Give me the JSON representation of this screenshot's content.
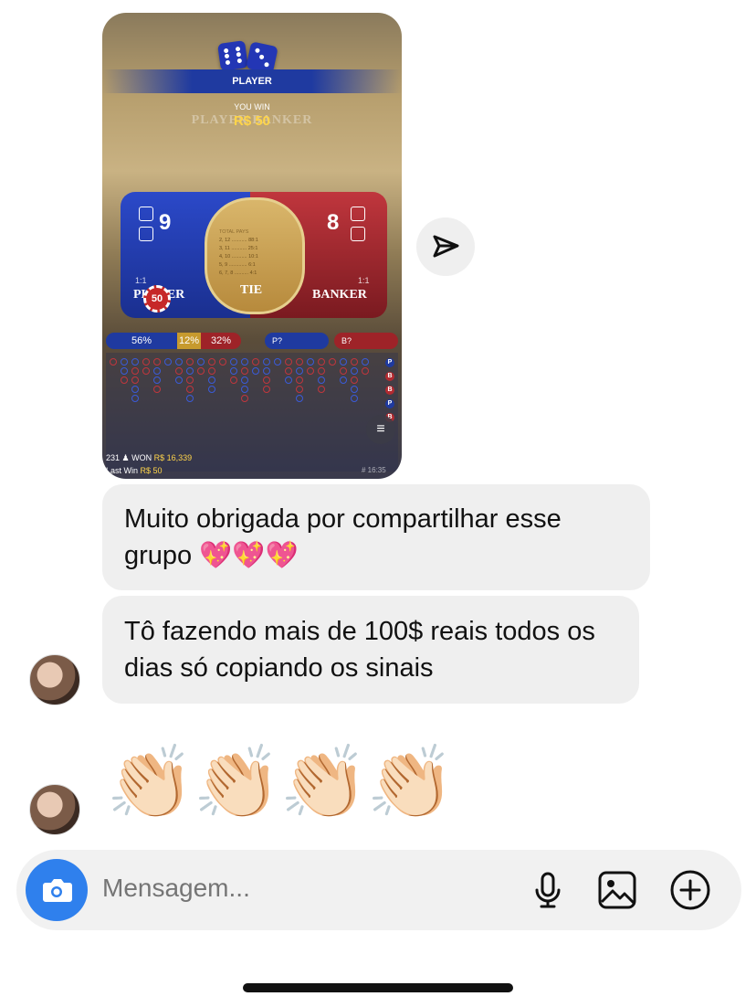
{
  "shared_image": {
    "banner_label": "PLAYER",
    "you_win_label": "YOU WIN",
    "win_amount": "R$ 50",
    "ghost_labels": "PLAYER   BANKER",
    "player_score": "9",
    "banker_score": "8",
    "player_odds": "1:1",
    "banker_odds": "1:1",
    "player_label": "PLAYER",
    "banker_label": "BANKER",
    "tie_label": "TIE",
    "paytable_header": "TOTAL      PAYS",
    "paytable_rows": [
      "2, 12 ........... 88:1",
      "3, 11 ........... 25:1",
      "4, 10 ........... 10:1",
      "5, 9 ............. 6:1",
      "6, 7, 8 .......... 4:1"
    ],
    "chip_value": "50",
    "stats_bar": {
      "player_pct": "56%",
      "tie_pct": "12%",
      "banker_pct": "32%"
    },
    "predict_player": "P?",
    "predict_banker": "B?",
    "road_side": [
      "P",
      "B",
      "B",
      "P",
      "B"
    ],
    "winners_count": "231",
    "won_label": "WON",
    "won_amount": "R$ 16,339",
    "last_win_label": "Last Win",
    "last_win_amount": "R$ 50",
    "game_id": "# 16:35"
  },
  "messages": [
    {
      "text": "Muito obrigada por compartilhar esse grupo 💖💖💖"
    },
    {
      "text": "Tô fazendo mais de 100$ reais todos os dias só copiando os sinais"
    },
    {
      "text": "👏🏻👏🏻👏🏻👏🏻"
    }
  ],
  "composer": {
    "placeholder": "Mensagem...",
    "icons": [
      "camera-icon",
      "microphone-icon",
      "gallery-icon",
      "plus-icon"
    ]
  },
  "colors": {
    "accent": "#2f80ed",
    "bubble": "#efefef",
    "player_blue": "#1f3aa0",
    "banker_red": "#b22a30"
  }
}
